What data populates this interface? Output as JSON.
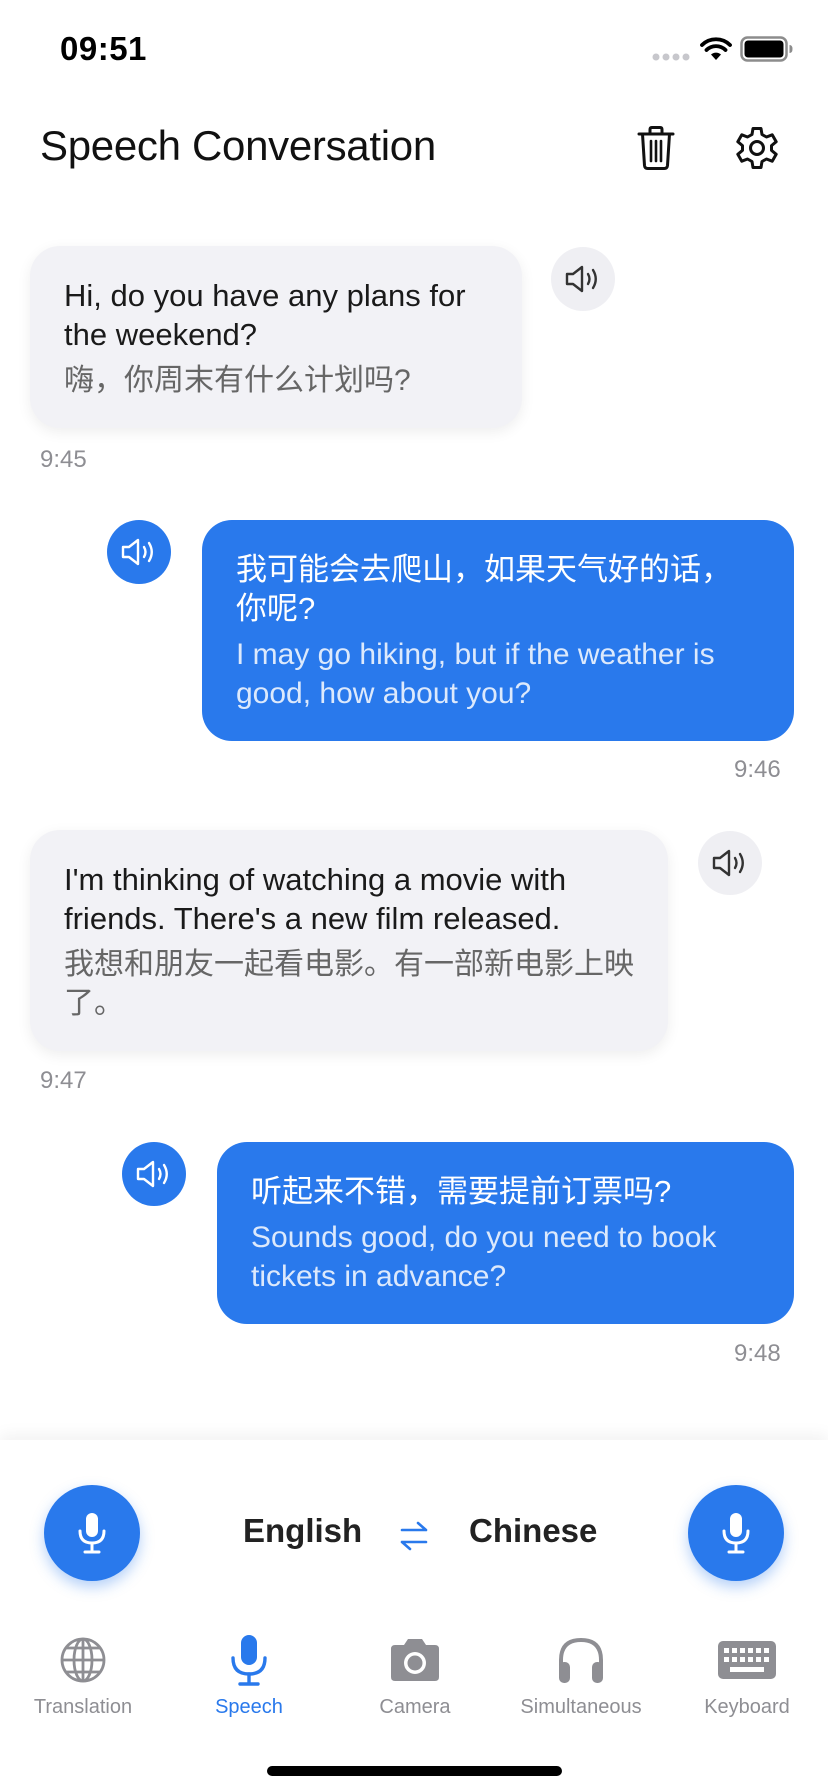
{
  "status_bar": {
    "time": "09:51"
  },
  "header": {
    "title": "Speech Conversation"
  },
  "messages": [
    {
      "side": "left",
      "line1": "Hi, do you have any plans for the weekend?",
      "line2": "嗨，你周末有什么计划吗?",
      "time": "9:45"
    },
    {
      "side": "right",
      "line1": "我可能会去爬山，如果天气好的话，你呢?",
      "line2": "I may go hiking, but if the weather is good, how about you?",
      "time": "9:46"
    },
    {
      "side": "left",
      "line1": "I'm thinking of watching a movie with friends. There's a new film released.",
      "line2": "我想和朋友一起看电影。有一部新电影上映了。",
      "time": "9:47"
    },
    {
      "side": "right",
      "line1": "听起来不错，需要提前订票吗?",
      "line2": "Sounds good, do you need to book tickets in advance?",
      "time": "9:48"
    }
  ],
  "languages": {
    "left": "English",
    "right": "Chinese"
  },
  "tabs": [
    {
      "label": "Translation",
      "icon": "globe-icon",
      "active": false
    },
    {
      "label": "Speech",
      "icon": "microphone-icon",
      "active": true
    },
    {
      "label": "Camera",
      "icon": "camera-icon",
      "active": false
    },
    {
      "label": "Simultaneous",
      "icon": "headphones-icon",
      "active": false
    },
    {
      "label": "Keyboard",
      "icon": "keyboard-icon",
      "active": false
    }
  ],
  "colors": {
    "accent": "#2979ec",
    "incoming_bubble": "#f2f2f6",
    "inactive": "#8e8e93"
  }
}
